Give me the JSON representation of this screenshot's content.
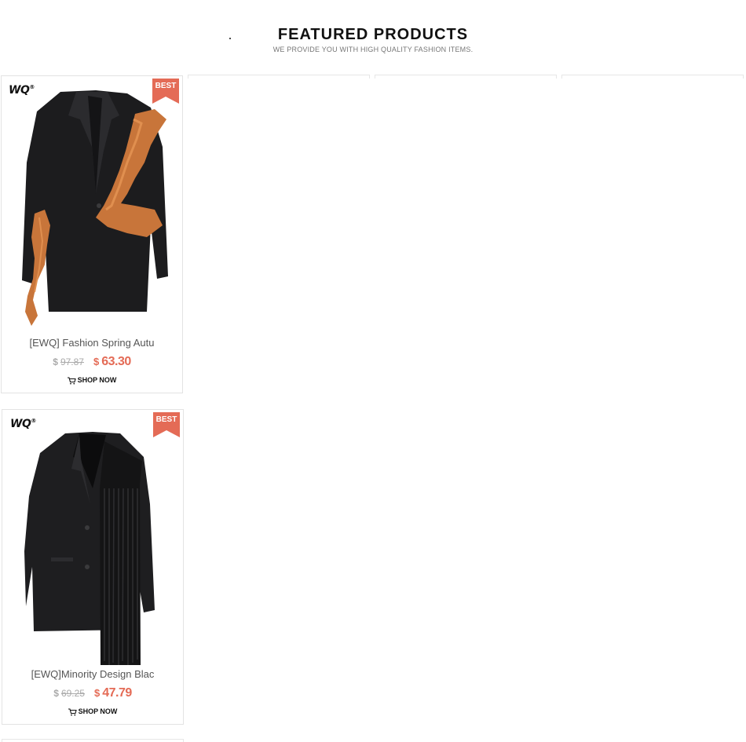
{
  "header": {
    "title": "FEATURED PRODUCTS",
    "subtitle": "WE PROVIDE YOU WITH HIGH QUALITY FASHION ITEMS."
  },
  "badge": "BEST",
  "logo": "WQ",
  "logo_mark": "®",
  "shop_label": "SHOP NOW",
  "products": [
    {
      "name": "[EWQ] Fashion Spring Autu",
      "old_currency": "$",
      "old_price": "97.87",
      "new_currency": "$",
      "new_price": "63.30",
      "image": "black blazer with orange ruffle trim"
    },
    {
      "name": "[EWQ]Minority Design Blac",
      "old_currency": "$",
      "old_price": "69.25",
      "new_currency": "$",
      "new_price": "47.79",
      "image": "black blazer with long fringe"
    }
  ],
  "colors": {
    "accent": "#e46b56",
    "muted": "#aaaaaa",
    "text": "#555555"
  }
}
